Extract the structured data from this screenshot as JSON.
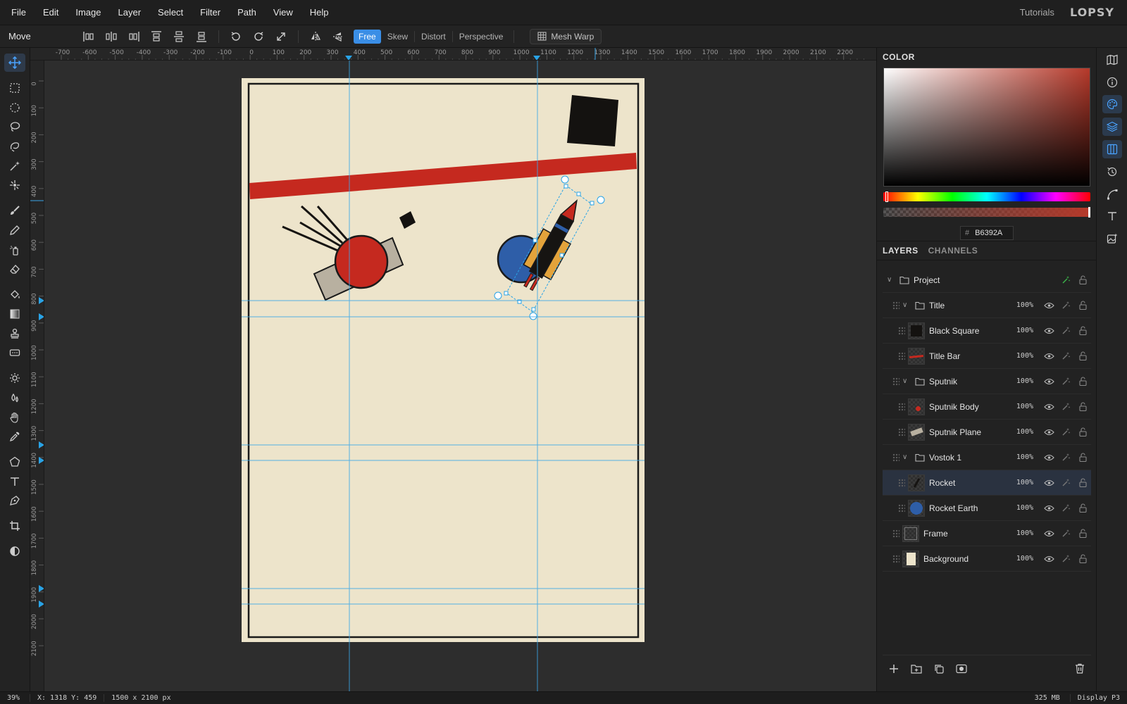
{
  "menu": [
    "File",
    "Edit",
    "Image",
    "Layer",
    "Select",
    "Filter",
    "Path",
    "View",
    "Help"
  ],
  "header": {
    "tutorials": "Tutorials",
    "logo": "LOPSY"
  },
  "options": {
    "tool_name": "Move",
    "modes": [
      "Free",
      "Skew",
      "Distort",
      "Perspective"
    ],
    "active_mode": "Free",
    "mesh_warp": "Mesh Warp"
  },
  "ruler": {
    "top": [
      "-700",
      "-600",
      "-500",
      "-400",
      "-300",
      "-200",
      "-100",
      "0",
      "100",
      "200",
      "300",
      "400",
      "500",
      "600",
      "700",
      "800",
      "900",
      "1000",
      "1100",
      "1200",
      "1300",
      "1400",
      "1500",
      "1600",
      "1700",
      "1800",
      "1900",
      "2000",
      "2100",
      "2200"
    ],
    "left": [
      "0",
      "100",
      "200",
      "300",
      "400",
      "500",
      "600",
      "700",
      "800",
      "900",
      "1000",
      "1100",
      "1200",
      "1300",
      "1400",
      "1500",
      "1600",
      "1700",
      "1800",
      "1900",
      "2000",
      "2100"
    ]
  },
  "color_panel": {
    "title": "COLOR",
    "hex_prefix": "#",
    "hex": "B6392A",
    "accent": "#b6392a"
  },
  "layers_panel": {
    "tabs": [
      "LAYERS",
      "CHANNELS"
    ],
    "rows": [
      {
        "name": "Project",
        "kind": "group",
        "level": 0,
        "opacity": "",
        "thumb": ""
      },
      {
        "name": "Title",
        "kind": "group",
        "level": 1,
        "opacity": "100%",
        "thumb": ""
      },
      {
        "name": "Black Square",
        "kind": "layer",
        "level": 2,
        "opacity": "100%",
        "thumb": "black-square"
      },
      {
        "name": "Title Bar",
        "kind": "layer",
        "level": 2,
        "opacity": "100%",
        "thumb": "title-bar"
      },
      {
        "name": "Sputnik",
        "kind": "group",
        "level": 1,
        "opacity": "100%",
        "thumb": ""
      },
      {
        "name": "Sputnik Body",
        "kind": "layer",
        "level": 2,
        "opacity": "100%",
        "thumb": "sputnik-body"
      },
      {
        "name": "Sputnik Plane",
        "kind": "layer",
        "level": 2,
        "opacity": "100%",
        "thumb": "sputnik-plane"
      },
      {
        "name": "Vostok 1",
        "kind": "group",
        "level": 1,
        "opacity": "100%",
        "thumb": ""
      },
      {
        "name": "Rocket",
        "kind": "layer",
        "level": 2,
        "opacity": "100%",
        "thumb": "rocket",
        "selected": true
      },
      {
        "name": "Rocket Earth",
        "kind": "layer",
        "level": 2,
        "opacity": "100%",
        "thumb": "rocket-earth"
      },
      {
        "name": "Frame",
        "kind": "layer",
        "level": 1,
        "opacity": "100%",
        "thumb": "frame"
      },
      {
        "name": "Background",
        "kind": "layer",
        "level": 1,
        "opacity": "100%",
        "thumb": "background"
      }
    ]
  },
  "status": {
    "zoom": "39%",
    "coords": "X: 1318 Y: 459",
    "doc_size": "1500 x 2100 px",
    "memory": "325 MB",
    "color_profile": "Display P3"
  }
}
